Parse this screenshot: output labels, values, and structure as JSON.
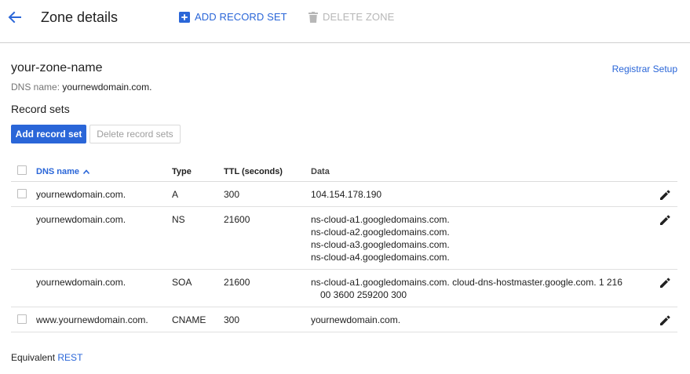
{
  "header": {
    "title": "Zone details",
    "add_record_set": "ADD RECORD SET",
    "delete_zone": "DELETE ZONE"
  },
  "zone": {
    "name": "your-zone-name",
    "dns_label": "DNS name:",
    "dns_value": "yournewdomain.com.",
    "registrar_link": "Registrar Setup"
  },
  "record_sets": {
    "title": "Record sets",
    "add_button": "Add record set",
    "delete_button": "Delete record sets"
  },
  "table": {
    "columns": {
      "dns_name": "DNS name",
      "type": "Type",
      "ttl": "TTL (seconds)",
      "data": "Data"
    },
    "rows": [
      {
        "dns": "yournewdomain.com.",
        "type": "A",
        "ttl": "300",
        "data": [
          "104.154.178.190"
        ]
      },
      {
        "dns": "yournewdomain.com.",
        "type": "NS",
        "ttl": "21600",
        "data": [
          "ns-cloud-a1.googledomains.com.",
          "ns-cloud-a2.googledomains.com.",
          "ns-cloud-a3.googledomains.com.",
          "ns-cloud-a4.googledomains.com."
        ]
      },
      {
        "dns": "yournewdomain.com.",
        "type": "SOA",
        "ttl": "21600",
        "data": [
          "ns-cloud-a1.googledomains.com. cloud-dns-hostmaster.google.com. 1 216",
          "00 3600 259200 300"
        ]
      },
      {
        "dns": "www.yournewdomain.com.",
        "type": "CNAME",
        "ttl": "300",
        "data": [
          "yournewdomain.com."
        ]
      }
    ]
  },
  "footer": {
    "label": "Equivalent",
    "link": "REST"
  },
  "colors": {
    "accent": "#2a66d8",
    "disabled": "#b7b7b7"
  }
}
